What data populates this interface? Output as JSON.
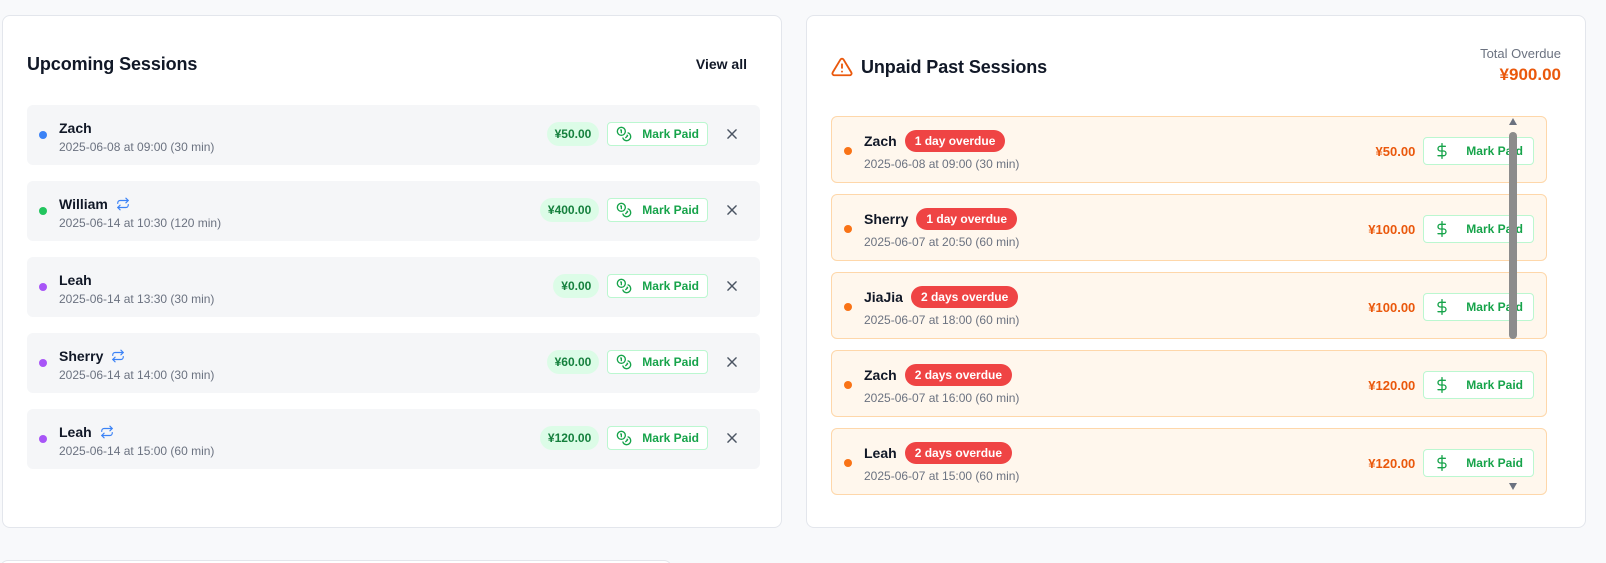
{
  "upcoming": {
    "title": "Upcoming Sessions",
    "view_all_label": "View all",
    "mark_paid_label": "Mark Paid",
    "items": [
      {
        "name": "Zach",
        "meta": "2025-06-08 at 09:00 (30 min)",
        "price": "¥50.00",
        "dot_color": "#3b82f6",
        "recurring": false
      },
      {
        "name": "William",
        "meta": "2025-06-14 at 10:30 (120 min)",
        "price": "¥400.00",
        "dot_color": "#22c55e",
        "recurring": true
      },
      {
        "name": "Leah",
        "meta": "2025-06-14 at 13:30 (30 min)",
        "price": "¥0.00",
        "dot_color": "#a855f7",
        "recurring": false
      },
      {
        "name": "Sherry",
        "meta": "2025-06-14 at 14:00 (30 min)",
        "price": "¥60.00",
        "dot_color": "#a855f7",
        "recurring": true
      },
      {
        "name": "Leah",
        "meta": "2025-06-14 at 15:00 (60 min)",
        "price": "¥120.00",
        "dot_color": "#a855f7",
        "recurring": true
      }
    ]
  },
  "unpaid": {
    "title": "Unpaid Past Sessions",
    "total_label": "Total Overdue",
    "total_value": "¥900.00",
    "mark_paid_label": "Mark Paid",
    "items": [
      {
        "name": "Zach",
        "badge": "1 day overdue",
        "meta": "2025-06-08 at 09:00 (30 min)",
        "price": "¥50.00"
      },
      {
        "name": "Sherry",
        "badge": "1 day overdue",
        "meta": "2025-06-07 at 20:50 (60 min)",
        "price": "¥100.00"
      },
      {
        "name": "JiaJia",
        "badge": "2 days overdue",
        "meta": "2025-06-07 at 18:00 (60 min)",
        "price": "¥100.00"
      },
      {
        "name": "Zach",
        "badge": "2 days overdue",
        "meta": "2025-06-07 at 16:00 (60 min)",
        "price": "¥120.00"
      },
      {
        "name": "Leah",
        "badge": "2 days overdue",
        "meta": "2025-06-07 at 15:00 (60 min)",
        "price": "¥120.00"
      }
    ]
  },
  "colors": {
    "accent_green": "#16a34a",
    "overdue_red": "#ef4444",
    "overdue_orange": "#ea580c"
  },
  "icons": {
    "warning": "warning-triangle-icon",
    "repeat": "repeat-icon",
    "coins": "coins-icon",
    "dollar": "dollar-icon",
    "close": "close-icon"
  }
}
